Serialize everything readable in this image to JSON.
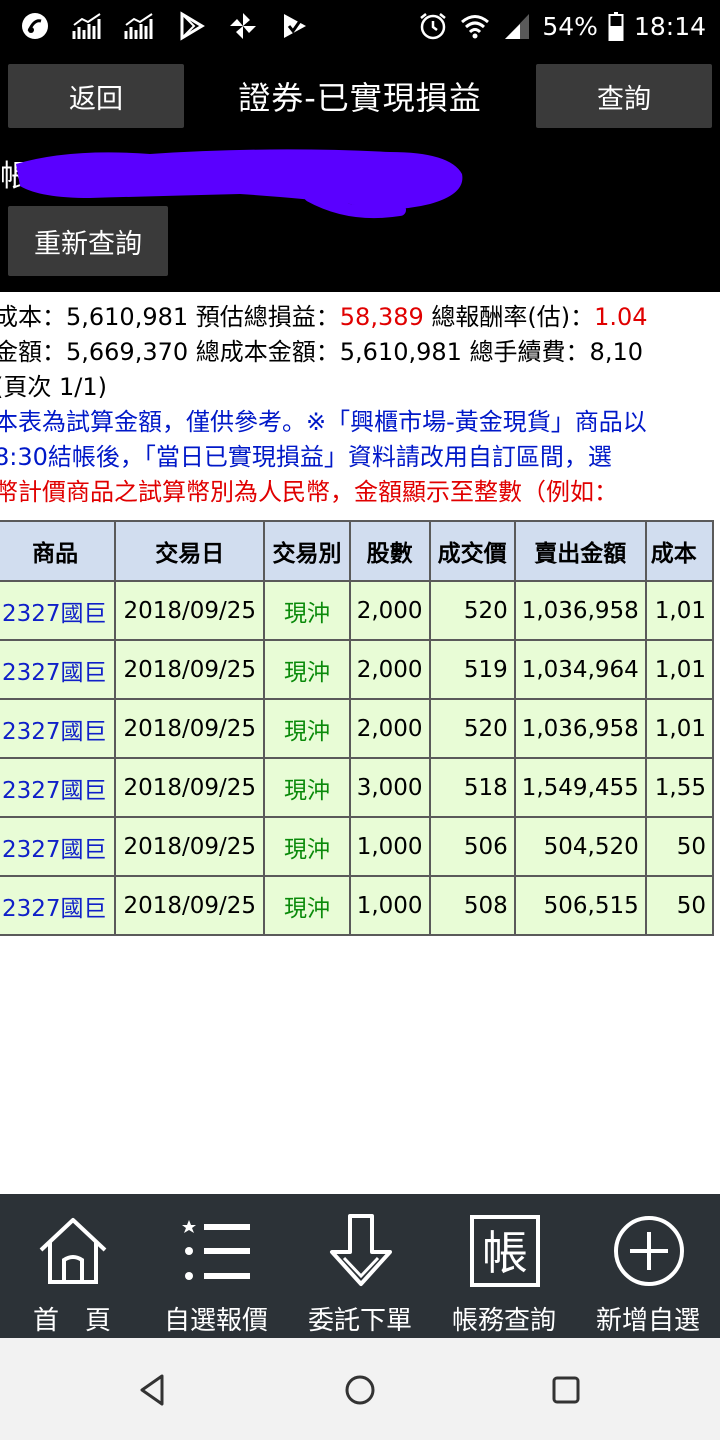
{
  "status_bar": {
    "battery": "54%",
    "time": "18:14",
    "left_icons": [
      "app-logo-icon",
      "signal-chart-icon",
      "signal-chart-icon",
      "play-store-icon",
      "pinwheel-icon",
      "check-flag-icon"
    ],
    "right_icons": [
      "alarm-icon",
      "wifi-icon",
      "cell-signal-icon",
      "battery-icon"
    ]
  },
  "header": {
    "back_label": "返回",
    "title": "證券-已實現損益",
    "query_label": "查詢",
    "account_label": "帳",
    "requery_label": "重新查詢"
  },
  "summary": {
    "line1_a": "成本：5,610,981  預估總損益：",
    "line1_profit": "58,389",
    "line1_b": "  總報酬率(估)：",
    "line1_rate": "1.04",
    "line2": "金額：5,669,370  總成本金額：5,610,981  總手續費：8,10",
    "line3": "(頁次 1/1)",
    "note1": "本表為試算金額，僅供參考。※「興櫃市場-黃金現貨」商品以",
    "note2": " 8:30結帳後，「當日已實現損益」資料請改用自訂區間，選",
    "note3": "幣計價商品之試算幣別為人民幣，金額顯示至整數（例如："
  },
  "table": {
    "headers": [
      "商品",
      "交易日",
      "交易別",
      "股數",
      "成交價",
      "賣出金額",
      "成本"
    ],
    "rows": [
      [
        "2327國巨",
        "2018/09/25",
        "現沖",
        "2,000",
        "520",
        "1,036,958",
        "1,01"
      ],
      [
        "2327國巨",
        "2018/09/25",
        "現沖",
        "2,000",
        "519",
        "1,034,964",
        "1,01"
      ],
      [
        "2327國巨",
        "2018/09/25",
        "現沖",
        "2,000",
        "520",
        "1,036,958",
        "1,01"
      ],
      [
        "2327國巨",
        "2018/09/25",
        "現沖",
        "3,000",
        "518",
        "1,549,455",
        "1,55"
      ],
      [
        "2327國巨",
        "2018/09/25",
        "現沖",
        "1,000",
        "506",
        "504,520",
        "50"
      ],
      [
        "2327國巨",
        "2018/09/25",
        "現沖",
        "1,000",
        "508",
        "506,515",
        "50"
      ]
    ]
  },
  "bottom_nav": [
    {
      "label": "首　頁",
      "icon": "home-icon"
    },
    {
      "label": "自選報價",
      "icon": "star-list-icon"
    },
    {
      "label": "委託下單",
      "icon": "down-arrow-icon"
    },
    {
      "label": "帳務查詢",
      "icon": "account-icon",
      "glyph": "帳"
    },
    {
      "label": "新增自選",
      "icon": "plus-circle-icon"
    }
  ],
  "colors": {
    "header_bg": "#000000",
    "button_bg": "#3a3a3a",
    "table_header_bg": "#d1ddef",
    "table_row_bg": "#e8fcd6",
    "profit_red": "#e00000",
    "note_blue": "#0018c8",
    "nav_bg": "#2c3237",
    "redaction": "#5a00ff"
  }
}
